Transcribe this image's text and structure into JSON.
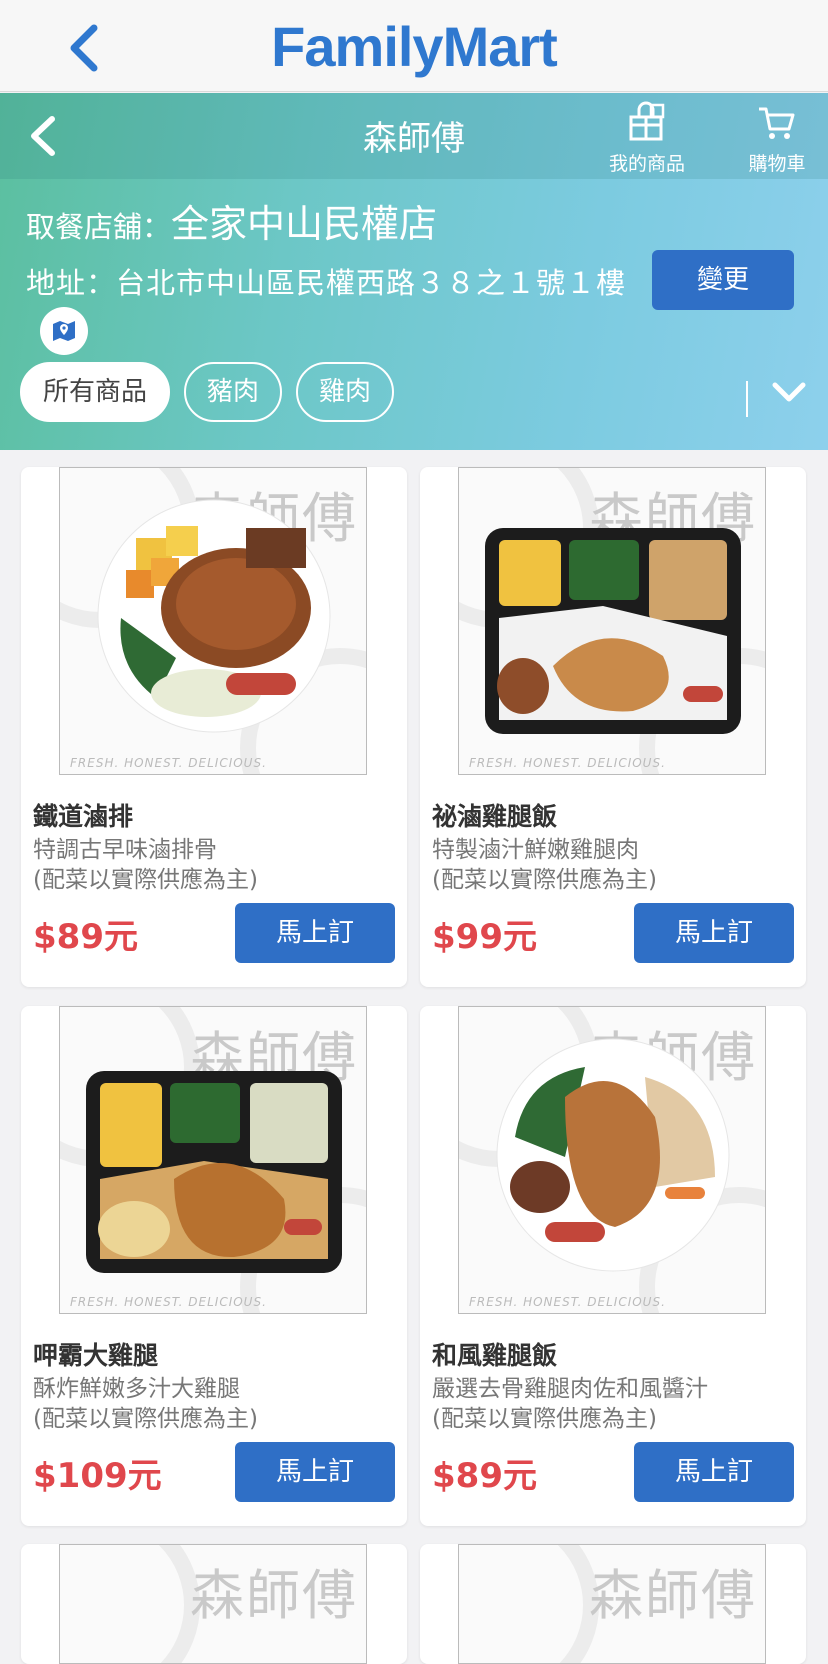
{
  "app": {
    "brand": "FamilyMart"
  },
  "header": {
    "title": "森師傅",
    "my_products": "我的商品",
    "cart": "購物車"
  },
  "store": {
    "label": "取餐店舖：",
    "name": "全家中山民權店",
    "address": "地址：台北市中山區民權西路３８之１號１樓",
    "change_label": "變更"
  },
  "filters": [
    {
      "label": "所有商品",
      "active": true
    },
    {
      "label": "豬肉",
      "active": false
    },
    {
      "label": "雞肉",
      "active": false
    }
  ],
  "watermark": {
    "brand": "森師傅",
    "tagline": "FRESH. HONEST. DELICIOUS."
  },
  "products": [
    {
      "name": "鐵道滷排",
      "desc": "特調古早味滷排骨",
      "note": "(配菜以實際供應為主)",
      "price": "$89元",
      "buy_label": "馬上訂"
    },
    {
      "name": "祕滷雞腿飯",
      "desc": "特製滷汁鮮嫩雞腿肉",
      "note": "(配菜以實際供應為主)",
      "price": "$99元",
      "buy_label": "馬上訂"
    },
    {
      "name": "呷霸大雞腿",
      "desc": "酥炸鮮嫩多汁大雞腿",
      "note": "(配菜以實際供應為主)",
      "price": "$109元",
      "buy_label": "馬上訂"
    },
    {
      "name": "和風雞腿飯",
      "desc": "嚴選去骨雞腿肉佐和風醬汁",
      "note": "(配菜以實際供應為主)",
      "price": "$89元",
      "buy_label": "馬上訂"
    }
  ],
  "colors": {
    "brand": "#2f78cf",
    "button": "#2f6fc6",
    "price": "#e0474c"
  }
}
